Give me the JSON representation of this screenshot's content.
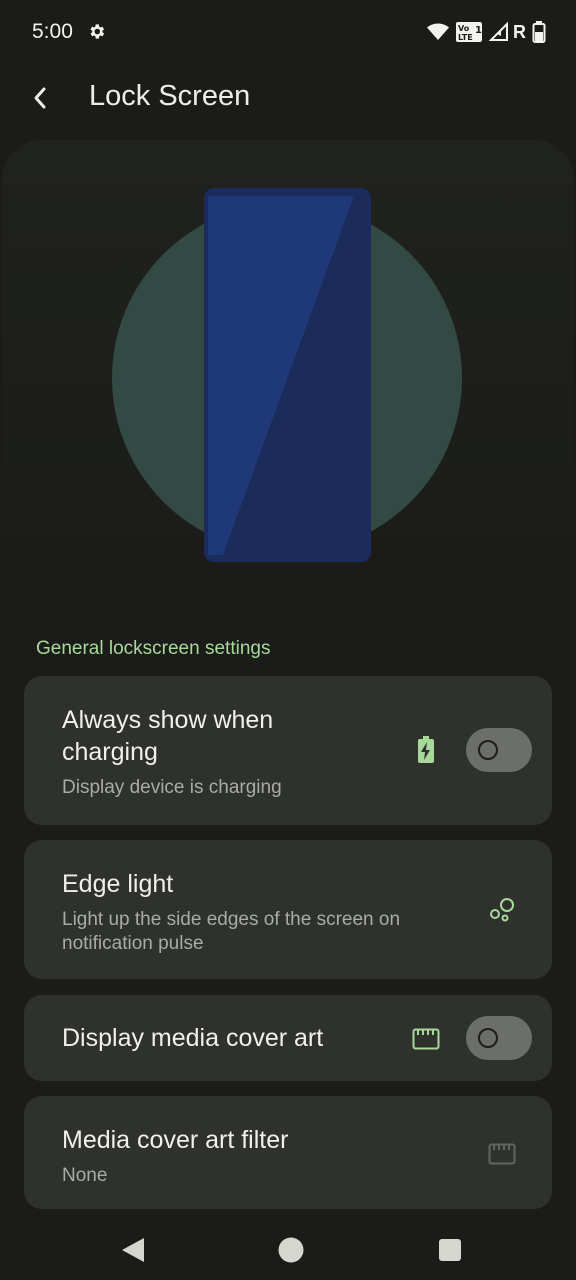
{
  "status_bar": {
    "time": "5:00",
    "icons": [
      "gear-icon",
      "wifi-icon",
      "volte-icon",
      "signal-icon",
      "battery-icon"
    ],
    "network_label": "R"
  },
  "app_bar": {
    "title": "Lock Screen",
    "back_icon": "chevron-left-icon"
  },
  "section": {
    "title": "General lockscreen settings"
  },
  "preferences": [
    {
      "title_line1": "Always show when",
      "title_line2": "charging",
      "summary": "Display device is charging",
      "icon": "battery-charging-icon",
      "toggle": false
    },
    {
      "title": "Edge light",
      "summary_line1": "Light up the side edges of the screen on",
      "summary_line2": "notification pulse",
      "icon": "bubbles-icon"
    },
    {
      "title": "Display media cover art",
      "icon": "media-frame-icon",
      "toggle": false
    },
    {
      "title": "Media cover art filter",
      "summary": "None",
      "icon": "media-frame-icon",
      "disabled": true
    }
  ],
  "nav_bar": {
    "icons": [
      "nav-back-icon",
      "nav-home-icon",
      "nav-recents-icon"
    ]
  },
  "colors": {
    "background": "#1b1c19",
    "card": "#2f312d",
    "accent": "#a7d99a",
    "circle": "#334943",
    "phone": "#1f3470"
  }
}
